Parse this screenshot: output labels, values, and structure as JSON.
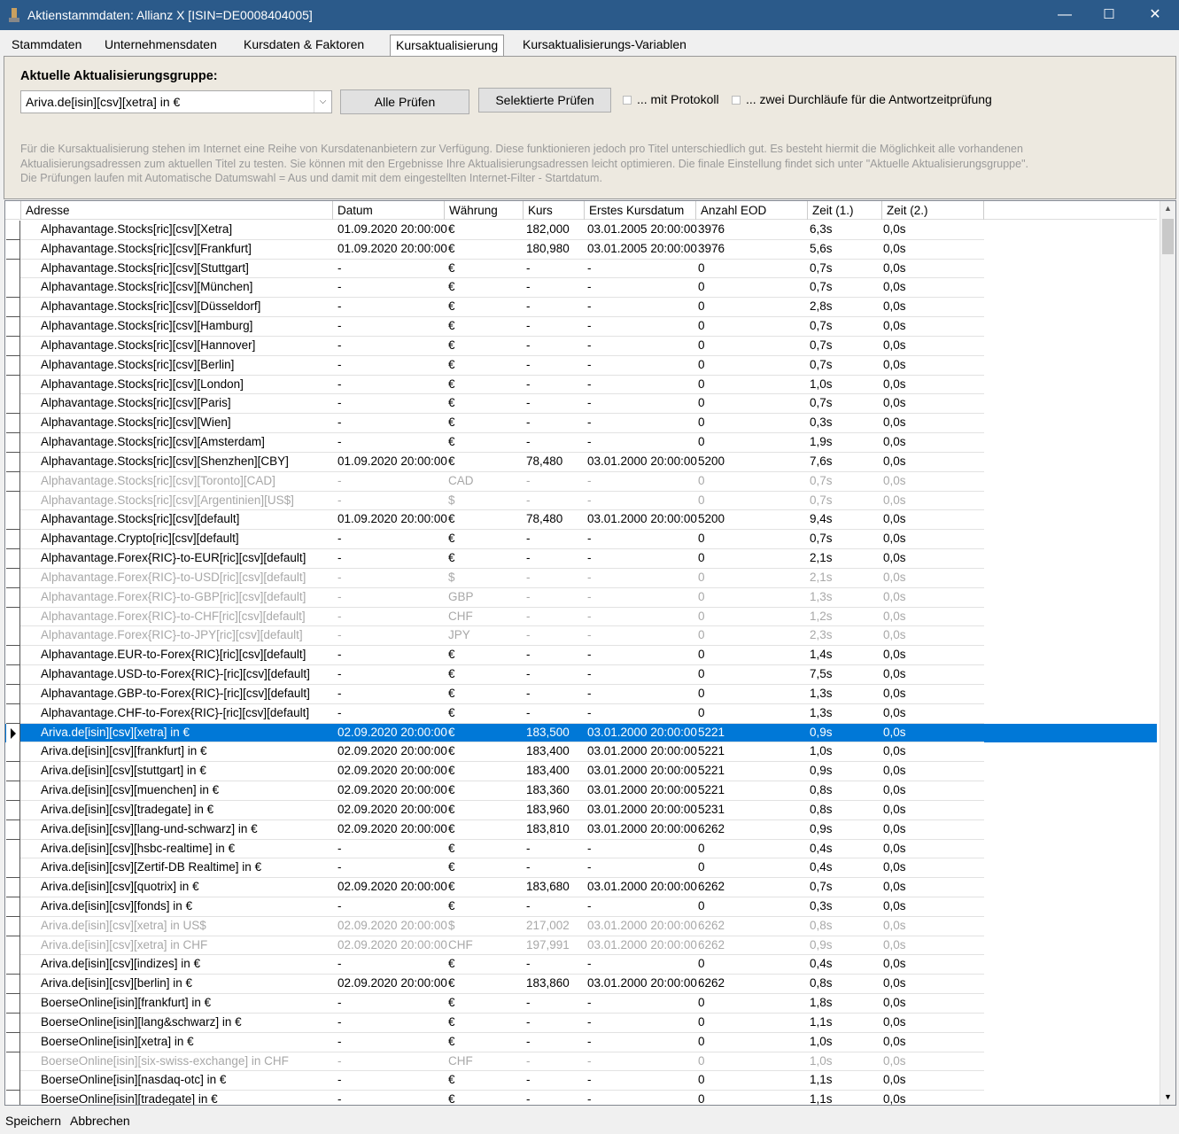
{
  "window": {
    "title": "Aktienstammdaten: Allianz X [ISIN=DE0008404005]",
    "minimize": "—",
    "maximize": "☐",
    "close": "✕"
  },
  "tabs": [
    {
      "label": "Stammdaten"
    },
    {
      "label": "Unternehmensdaten"
    },
    {
      "label": "Kursdaten &  Faktoren"
    },
    {
      "label": "Kursaktualisierung",
      "active": true
    },
    {
      "label": "Kursaktualisierungs-Variablen"
    }
  ],
  "panel": {
    "group_label": "Aktuelle Aktualisierungsgruppe:",
    "group_value": "Ariva.de[isin][csv][xetra] in €",
    "btn_all": "Alle Prüfen",
    "btn_selected": "Selektierte Prüfen",
    "chk_protokoll": "... mit Protokoll",
    "chk_zwei": "... zwei Durchläufe für die Antwortzeitprüfung",
    "info": "Für die Kursaktualisierung stehen im Internet eine Reihe von Kursdatenanbietern zur Verfügung. Diese funktionieren jedoch pro Titel unterschiedlich gut. Es besteht hiermit die Möglichkeit alle vorhandenen Aktualisierungsadressen zum aktuellen Titel zu testen. Sie können mit den Ergebnisse Ihre Aktualisierungsadressen leicht optimieren. Die finale Einstellung findet sich unter \"Aktuelle Aktualisierungsgruppe\". Die Prüfungen laufen mit Automatische Datumswahl = Aus und damit mit dem eingestellten  Internet-Filter - Startdatum."
  },
  "grid": {
    "columns": [
      "Adresse",
      "Datum",
      "Währung",
      "Kurs",
      "Erstes Kursdatum",
      "Anzahl EOD",
      "Zeit (1.)",
      "Zeit (2.)"
    ],
    "rows": [
      {
        "cells": [
          "Alphavantage.Stocks[ric][csv][Xetra]",
          "01.09.2020 20:00:00",
          "€",
          "182,000",
          "03.01.2005 20:00:00",
          "3976",
          "6,3s",
          "0,0s"
        ]
      },
      {
        "cells": [
          "Alphavantage.Stocks[ric][csv][Frankfurt]",
          "01.09.2020 20:00:00",
          "€",
          "180,980",
          "03.01.2005 20:00:00",
          "3976",
          "5,6s",
          "0,0s"
        ]
      },
      {
        "cells": [
          "Alphavantage.Stocks[ric][csv][Stuttgart]",
          "-",
          "€",
          "-",
          "-",
          "0",
          "0,7s",
          "0,0s"
        ]
      },
      {
        "cells": [
          "Alphavantage.Stocks[ric][csv][München]",
          "-",
          "€",
          "-",
          "-",
          "0",
          "0,7s",
          "0,0s"
        ]
      },
      {
        "cells": [
          "Alphavantage.Stocks[ric][csv][Düsseldorf]",
          "-",
          "€",
          "-",
          "-",
          "0",
          "2,8s",
          "0,0s"
        ]
      },
      {
        "cells": [
          "Alphavantage.Stocks[ric][csv][Hamburg]",
          "-",
          "€",
          "-",
          "-",
          "0",
          "0,7s",
          "0,0s"
        ]
      },
      {
        "cells": [
          "Alphavantage.Stocks[ric][csv][Hannover]",
          "-",
          "€",
          "-",
          "-",
          "0",
          "0,7s",
          "0,0s"
        ]
      },
      {
        "cells": [
          "Alphavantage.Stocks[ric][csv][Berlin]",
          "-",
          "€",
          "-",
          "-",
          "0",
          "0,7s",
          "0,0s"
        ]
      },
      {
        "cells": [
          "Alphavantage.Stocks[ric][csv][London]",
          "-",
          "€",
          "-",
          "-",
          "0",
          "1,0s",
          "0,0s"
        ]
      },
      {
        "cells": [
          "Alphavantage.Stocks[ric][csv][Paris]",
          "-",
          "€",
          "-",
          "-",
          "0",
          "0,7s",
          "0,0s"
        ]
      },
      {
        "cells": [
          "Alphavantage.Stocks[ric][csv][Wien]",
          "-",
          "€",
          "-",
          "-",
          "0",
          "0,3s",
          "0,0s"
        ]
      },
      {
        "cells": [
          "Alphavantage.Stocks[ric][csv][Amsterdam]",
          "-",
          "€",
          "-",
          "-",
          "0",
          "1,9s",
          "0,0s"
        ]
      },
      {
        "cells": [
          "Alphavantage.Stocks[ric][csv][Shenzhen][CBY]",
          "01.09.2020 20:00:00",
          "€",
          "78,480",
          "03.01.2000 20:00:00",
          "5200",
          "7,6s",
          "0,0s"
        ]
      },
      {
        "cells": [
          "Alphavantage.Stocks[ric][csv][Toronto][CAD]",
          "-",
          "CAD",
          "-",
          "-",
          "0",
          "0,7s",
          "0,0s"
        ],
        "disabled": true
      },
      {
        "cells": [
          "Alphavantage.Stocks[ric][csv][Argentinien][US$]",
          "-",
          "$",
          "-",
          "-",
          "0",
          "0,7s",
          "0,0s"
        ],
        "disabled": true
      },
      {
        "cells": [
          "Alphavantage.Stocks[ric][csv][default]",
          "01.09.2020 20:00:00",
          "€",
          "78,480",
          "03.01.2000 20:00:00",
          "5200",
          "9,4s",
          "0,0s"
        ]
      },
      {
        "cells": [
          "Alphavantage.Crypto[ric][csv][default]",
          "-",
          "€",
          "-",
          "-",
          "0",
          "0,7s",
          "0,0s"
        ]
      },
      {
        "cells": [
          "Alphavantage.Forex{RIC}-to-EUR[ric][csv][default]",
          "-",
          "€",
          "-",
          "-",
          "0",
          "2,1s",
          "0,0s"
        ]
      },
      {
        "cells": [
          "Alphavantage.Forex{RIC}-to-USD[ric][csv][default]",
          "-",
          "$",
          "-",
          "-",
          "0",
          "2,1s",
          "0,0s"
        ],
        "disabled": true
      },
      {
        "cells": [
          "Alphavantage.Forex{RIC}-to-GBP[ric][csv][default]",
          "-",
          "GBP",
          "-",
          "-",
          "0",
          "1,3s",
          "0,0s"
        ],
        "disabled": true
      },
      {
        "cells": [
          "Alphavantage.Forex{RIC}-to-CHF[ric][csv][default]",
          "-",
          "CHF",
          "-",
          "-",
          "0",
          "1,2s",
          "0,0s"
        ],
        "disabled": true
      },
      {
        "cells": [
          "Alphavantage.Forex{RIC}-to-JPY[ric][csv][default]",
          "-",
          "JPY",
          "-",
          "-",
          "0",
          "2,3s",
          "0,0s"
        ],
        "disabled": true
      },
      {
        "cells": [
          "Alphavantage.EUR-to-Forex{RIC}[ric][csv][default]",
          "-",
          "€",
          "-",
          "-",
          "0",
          "1,4s",
          "0,0s"
        ]
      },
      {
        "cells": [
          "Alphavantage.USD-to-Forex{RIC}-[ric][csv][default]",
          "-",
          "€",
          "-",
          "-",
          "0",
          "7,5s",
          "0,0s"
        ]
      },
      {
        "cells": [
          "Alphavantage.GBP-to-Forex{RIC}-[ric][csv][default]",
          "-",
          "€",
          "-",
          "-",
          "0",
          "1,3s",
          "0,0s"
        ]
      },
      {
        "cells": [
          "Alphavantage.CHF-to-Forex{RIC}-[ric][csv][default]",
          "-",
          "€",
          "-",
          "-",
          "0",
          "1,3s",
          "0,0s"
        ]
      },
      {
        "cells": [
          "Ariva.de[isin][csv][xetra] in €",
          "02.09.2020 20:00:00",
          "€",
          "183,500",
          "03.01.2000 20:00:00",
          "5221",
          "0,9s",
          "0,0s"
        ],
        "selected": true
      },
      {
        "cells": [
          "Ariva.de[isin][csv][frankfurt] in €",
          "02.09.2020 20:00:00",
          "€",
          "183,400",
          "03.01.2000 20:00:00",
          "5221",
          "1,0s",
          "0,0s"
        ]
      },
      {
        "cells": [
          "Ariva.de[isin][csv][stuttgart] in €",
          "02.09.2020 20:00:00",
          "€",
          "183,400",
          "03.01.2000 20:00:00",
          "5221",
          "0,9s",
          "0,0s"
        ]
      },
      {
        "cells": [
          "Ariva.de[isin][csv][muenchen] in €",
          "02.09.2020 20:00:00",
          "€",
          "183,360",
          "03.01.2000 20:00:00",
          "5221",
          "0,8s",
          "0,0s"
        ]
      },
      {
        "cells": [
          "Ariva.de[isin][csv][tradegate] in €",
          "02.09.2020 20:00:00",
          "€",
          "183,960",
          "03.01.2000 20:00:00",
          "5231",
          "0,8s",
          "0,0s"
        ]
      },
      {
        "cells": [
          "Ariva.de[isin][csv][lang-und-schwarz] in €",
          "02.09.2020 20:00:00",
          "€",
          "183,810",
          "03.01.2000 20:00:00",
          "6262",
          "0,9s",
          "0,0s"
        ]
      },
      {
        "cells": [
          "Ariva.de[isin][csv][hsbc-realtime] in €",
          "-",
          "€",
          "-",
          "-",
          "0",
          "0,4s",
          "0,0s"
        ]
      },
      {
        "cells": [
          "Ariva.de[isin][csv][Zertif-DB Realtime] in €",
          "-",
          "€",
          "-",
          "-",
          "0",
          "0,4s",
          "0,0s"
        ]
      },
      {
        "cells": [
          "Ariva.de[isin][csv][quotrix] in €",
          "02.09.2020 20:00:00",
          "€",
          "183,680",
          "03.01.2000 20:00:00",
          "6262",
          "0,7s",
          "0,0s"
        ]
      },
      {
        "cells": [
          "Ariva.de[isin][csv][fonds] in €",
          "-",
          "€",
          "-",
          "-",
          "0",
          "0,3s",
          "0,0s"
        ]
      },
      {
        "cells": [
          "Ariva.de[isin][csv][xetra] in US$",
          "02.09.2020 20:00:00",
          "$",
          "217,002",
          "03.01.2000 20:00:00",
          "6262",
          "0,8s",
          "0,0s"
        ],
        "disabled": true
      },
      {
        "cells": [
          "Ariva.de[isin][csv][xetra] in CHF",
          "02.09.2020 20:00:00",
          "CHF",
          "197,991",
          "03.01.2000 20:00:00",
          "6262",
          "0,9s",
          "0,0s"
        ],
        "disabled": true
      },
      {
        "cells": [
          "Ariva.de[isin][csv][indizes] in €",
          "-",
          "€",
          "-",
          "-",
          "0",
          "0,4s",
          "0,0s"
        ]
      },
      {
        "cells": [
          "Ariva.de[isin][csv][berlin] in €",
          "02.09.2020 20:00:00",
          "€",
          "183,860",
          "03.01.2000 20:00:00",
          "6262",
          "0,8s",
          "0,0s"
        ]
      },
      {
        "cells": [
          "BoerseOnline[isin][frankfurt] in €",
          "-",
          "€",
          "-",
          "-",
          "0",
          "1,8s",
          "0,0s"
        ]
      },
      {
        "cells": [
          "BoerseOnline[isin][lang&schwarz] in €",
          "-",
          "€",
          "-",
          "-",
          "0",
          "1,1s",
          "0,0s"
        ]
      },
      {
        "cells": [
          "BoerseOnline[isin][xetra] in €",
          "-",
          "€",
          "-",
          "-",
          "0",
          "1,0s",
          "0,0s"
        ]
      },
      {
        "cells": [
          "BoerseOnline[isin][six-swiss-exchange] in CHF",
          "-",
          "CHF",
          "-",
          "-",
          "0",
          "1,0s",
          "0,0s"
        ],
        "disabled": true
      },
      {
        "cells": [
          "BoerseOnline[isin][nasdaq-otc] in €",
          "-",
          "€",
          "-",
          "-",
          "0",
          "1,1s",
          "0,0s"
        ]
      },
      {
        "cells": [
          "BoerseOnline[isin][tradegate] in €",
          "-",
          "€",
          "-",
          "-",
          "0",
          "1,1s",
          "0,0s"
        ]
      }
    ]
  },
  "footer": {
    "save": "Speichern",
    "cancel": "Abbrechen"
  },
  "colors": {
    "titlebar": "#2b5a8a",
    "selection": "#0078d7",
    "disabled_text": "#a8a8a8"
  }
}
